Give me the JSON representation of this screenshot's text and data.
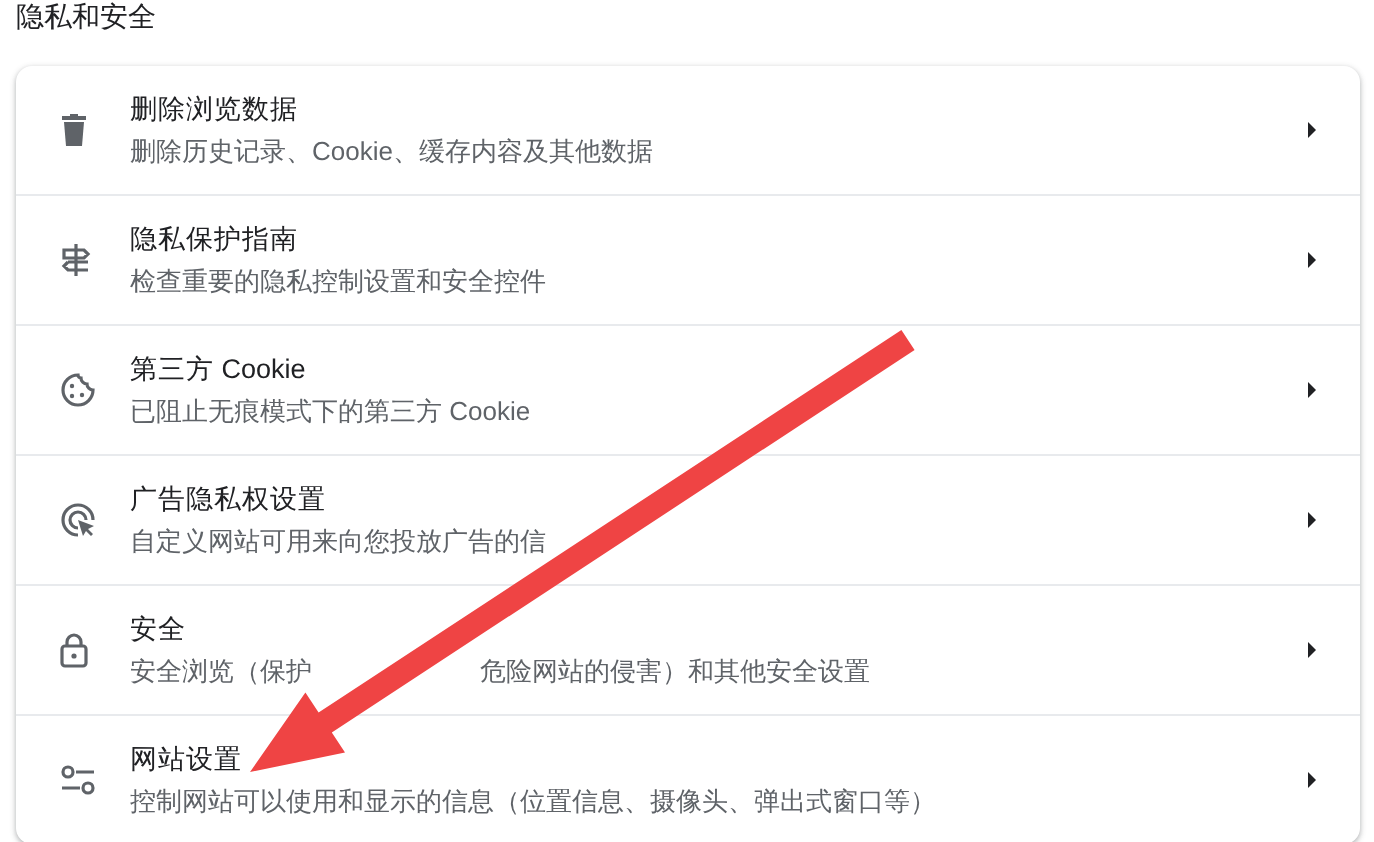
{
  "section_title": "隐私和安全",
  "items": [
    {
      "kind": "trash",
      "title": "删除浏览数据",
      "subtitle": [
        "删除历史记录、Cookie、缓存内容及其他数据"
      ]
    },
    {
      "kind": "guide",
      "title": "隐私保护指南",
      "subtitle": [
        "检查重要的隐私控制设置和安全控件"
      ]
    },
    {
      "kind": "cookie",
      "title": "第三方 Cookie",
      "subtitle": [
        "已阻止无痕模式下的第三方 Cookie"
      ]
    },
    {
      "kind": "ads",
      "title": "广告隐私权设置",
      "subtitle": [
        "自定义网站可用来向您投放广告的信"
      ]
    },
    {
      "kind": "lock",
      "title": "安全",
      "subtitle": [
        "安全浏览（保护",
        "危险网站的侵害）和其他安全设置"
      ]
    },
    {
      "kind": "tune",
      "title": "网站设置",
      "subtitle": [
        "控制网站可以使用和显示的信息（位置信息、摄像头、弹出式窗口等）"
      ]
    }
  ]
}
